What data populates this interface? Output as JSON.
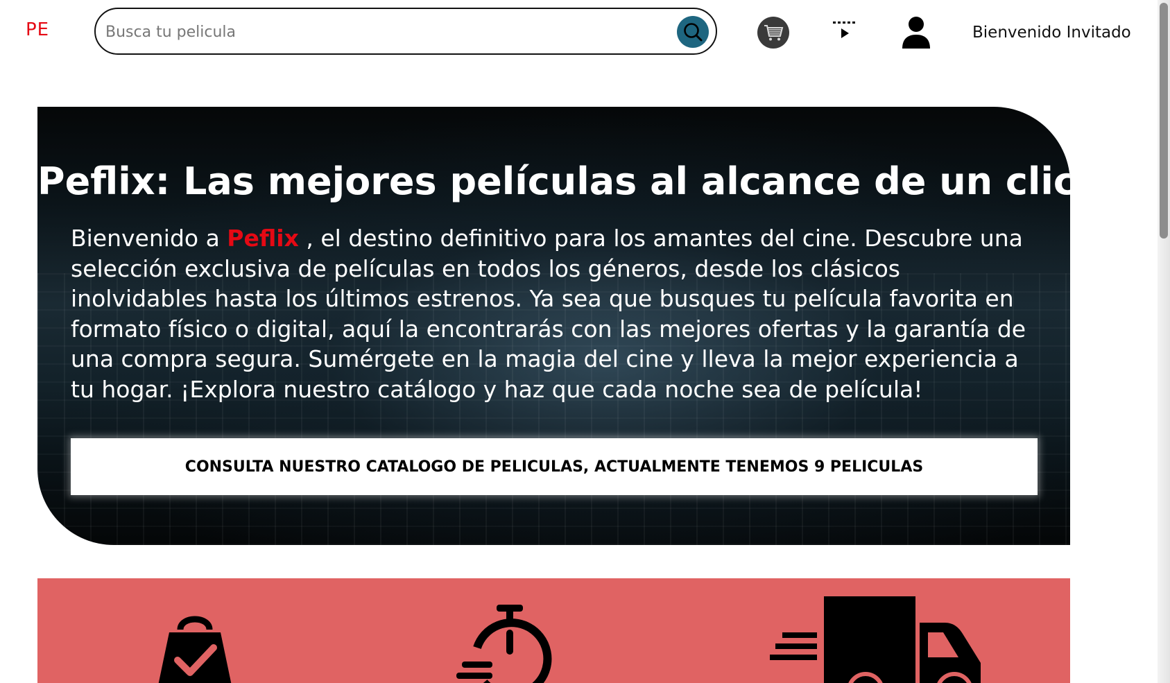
{
  "header": {
    "logo": "PE",
    "search": {
      "placeholder": "Busca tu pelicula",
      "value": ""
    },
    "icons": [
      "search-icon",
      "cart-icon",
      "playlist-play-icon",
      "user-icon"
    ],
    "welcome": "Bienvenido Invitado"
  },
  "hero": {
    "title": "Peflix: Las mejores películas al alcance de un click",
    "text_before": "Bienvenido a ",
    "brand": "Peflix",
    "text_after": " , el destino definitivo para los amantes del cine. Descubre una selección exclusiva de películas en todos los géneros, desde los clásicos inolvidables hasta los últimos estrenos. Ya sea que busques tu película favorita en formato físico o digital, aquí la encontrarás con las mejores ofertas y la garantía de una compra segura. Sumérgete en la magia del cine y lleva la mejor experiencia a tu hogar. ¡Explora nuestro catálogo y haz que cada noche sea de película!",
    "button": "CONSULTA NUESTRO CATALOGO DE PELICULAS, ACTUALMENTE TENEMOS 9 PELICULAS"
  },
  "features": {
    "icons": [
      "shopping-bag-check-icon",
      "fast-timer-icon",
      "fast-delivery-truck-icon"
    ]
  },
  "colors": {
    "brand": "#e50914",
    "search_button": "#1e6680",
    "features_band": "#e06363"
  }
}
